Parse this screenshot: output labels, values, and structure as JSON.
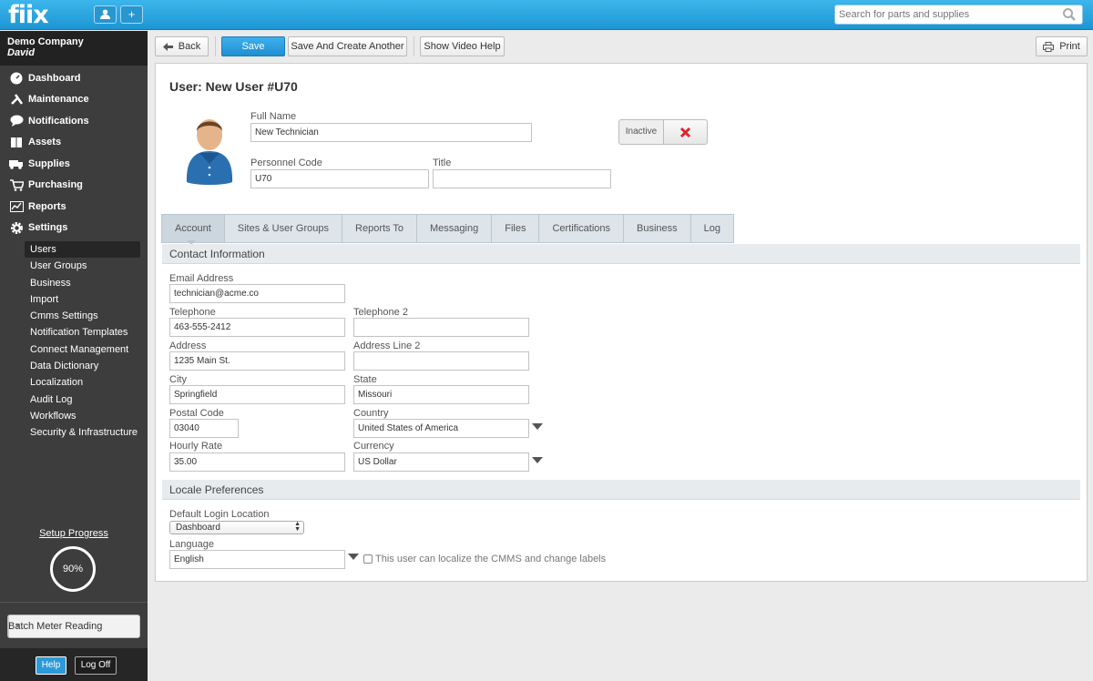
{
  "app": {
    "logo": "fiix",
    "search_placeholder": "Search for parts and supplies"
  },
  "sidebar": {
    "company": "Demo Company",
    "user": "David",
    "nav": [
      {
        "label": "Dashboard",
        "icon": "dashboard-icon"
      },
      {
        "label": "Maintenance",
        "icon": "wrench-icon"
      },
      {
        "label": "Notifications",
        "icon": "chat-bubble-icon"
      },
      {
        "label": "Assets",
        "icon": "boxes-icon"
      },
      {
        "label": "Supplies",
        "icon": "truck-icon"
      },
      {
        "label": "Purchasing",
        "icon": "cart-icon"
      },
      {
        "label": "Reports",
        "icon": "chart-icon"
      },
      {
        "label": "Settings",
        "icon": "gear-icon"
      }
    ],
    "settings_items": [
      "Users",
      "User Groups",
      "Business",
      "Import",
      "Cmms Settings",
      "Notification Templates",
      "Connect Management",
      "Data Dictionary",
      "Localization",
      "Audit Log",
      "Workflows",
      "Security & Infrastructure"
    ],
    "active_setting": "Users",
    "setup_progress_label": "Setup Progress",
    "setup_progress_value": "90%",
    "batch_label": "Batch Meter Reading",
    "help_label": "Help",
    "logoff_label": "Log Off"
  },
  "toolbar": {
    "back": "Back",
    "save": "Save",
    "save_create": "Save And Create Another",
    "video_help": "Show Video Help",
    "print": "Print"
  },
  "user": {
    "page_title": "User: New User #U70",
    "full_name_label": "Full Name",
    "full_name": "New Technician",
    "personnel_code_label": "Personnel Code",
    "personnel_code": "U70",
    "title_label": "Title",
    "title": "",
    "status_label": "Inactive"
  },
  "tabs": [
    "Account",
    "Sites & User Groups",
    "Reports To",
    "Messaging",
    "Files",
    "Certifications",
    "Business",
    "Log"
  ],
  "contact": {
    "section_title": "Contact Information",
    "email_label": "Email Address",
    "email": "technician@acme.co",
    "phone_label": "Telephone",
    "phone": "463-555-2412",
    "phone2_label": "Telephone 2",
    "phone2": "",
    "address_label": "Address",
    "address": "1235 Main St.",
    "address2_label": "Address Line 2",
    "address2": "",
    "city_label": "City",
    "city": "Springfield",
    "state_label": "State",
    "state": "Missouri",
    "postal_label": "Postal Code",
    "postal": "03040",
    "country_label": "Country",
    "country": "United States of America",
    "rate_label": "Hourly Rate",
    "rate": "35.00",
    "currency_label": "Currency",
    "currency": "US Dollar"
  },
  "locale": {
    "section_title": "Locale Preferences",
    "login_location_label": "Default Login Location",
    "login_location": "Dashboard",
    "language_label": "Language",
    "language": "English",
    "localize_checkbox_label": "This user can localize the CMMS and change labels"
  }
}
